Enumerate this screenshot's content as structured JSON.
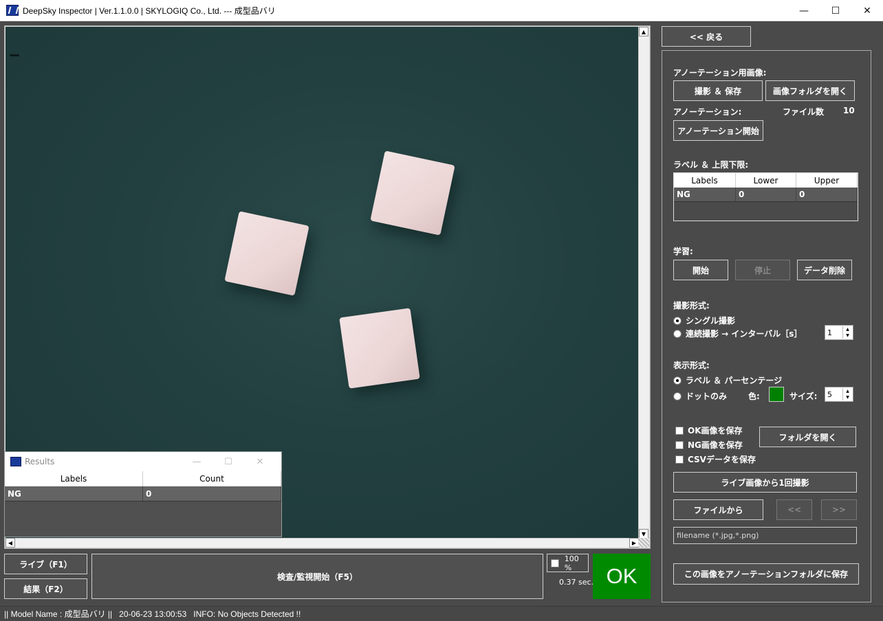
{
  "window": {
    "title": "DeepSky Inspector | Ver.1.1.0.0 | SKYLOGIQ Co., Ltd. --- 成型品バリ",
    "min_glyph": "—",
    "max_glyph": "☐",
    "close_glyph": "✕"
  },
  "viewer": {
    "scroll_up": "▲",
    "scroll_down": "▼",
    "scroll_left": "◀",
    "scroll_right": "▶"
  },
  "results_window": {
    "title": "Results",
    "columns": [
      "Labels",
      "Count"
    ],
    "rows": [
      {
        "label": "NG",
        "count": "0"
      }
    ],
    "min_glyph": "—",
    "max_glyph": "☐",
    "close_glyph": "✕"
  },
  "bottom": {
    "live_button": "ライブ（F1）",
    "results_button": "結果（F2）",
    "inspect_button": "検査/監視開始（F5）",
    "zoom": "100 %",
    "elapsed": "0.37 sec.",
    "verdict": "OK",
    "verdict_color": "#008a00"
  },
  "status_bar": {
    "model": "|| Model Name : 成型品バリ ||",
    "datetime": "20-06-23 13:00:53",
    "info": "INFO:   No Objects Detected !!"
  },
  "panel": {
    "back_button": "<< 戻る",
    "annotation_images_label": "アノーテーション用画像:",
    "capture_save_button": "撮影 ＆ 保存",
    "open_image_folder_button": "画像フォルダを開く",
    "annotation_label": "アノーテーション:",
    "file_count_label": "ファイル数",
    "file_count": "10",
    "annotation_start_button": "アノーテーション開始",
    "label_limits_label": "ラベル ＆ 上限下限:",
    "limits_columns": [
      "Labels",
      "Lower",
      "Upper"
    ],
    "limits_rows": [
      {
        "label": "NG",
        "lower": "0",
        "upper": "0"
      }
    ],
    "learning_label": "学習:",
    "start_button": "開始",
    "stop_button": "停止",
    "delete_data_button": "データ削除",
    "capture_mode_label": "撮影形式:",
    "single_capture": "シングル撮影",
    "continuous_capture": "連続撮影 → インターバル［s］",
    "interval": "1",
    "display_mode_label": "表示形式:",
    "label_percentage": "ラベル ＆ パーセンテージ",
    "dots_only": "ドットのみ",
    "color_label": "色:",
    "dot_color": "#008000",
    "size_label": "サイズ:",
    "size": "5",
    "save_ok": "OK画像を保存",
    "save_ng": "NG画像を保存",
    "save_csv": "CSVデータを保存",
    "open_folder_button": "フォルダを開く",
    "capture_once_button": "ライブ画像から1回撮影",
    "from_file_button": "ファイルから",
    "prev_button": "<<",
    "next_button": ">>",
    "filename_placeholder": "filename (*.jpg,*.png)",
    "save_to_annotation_button": "この画像をアノーテーションフォルダに保存"
  }
}
